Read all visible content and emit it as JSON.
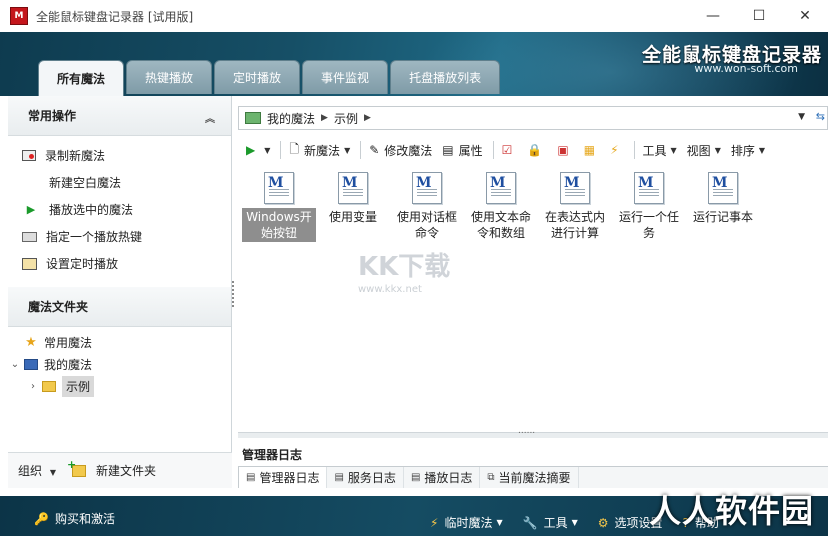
{
  "window": {
    "title": "全能鼠标键盘记录器 [试用版]",
    "logo": "M",
    "minimize": "—",
    "maximize": "☐",
    "close": "✕"
  },
  "header": {
    "brand": "全能鼠标键盘记录器",
    "url": "www.won-soft.com"
  },
  "tabs": [
    {
      "label": "所有魔法",
      "active": true
    },
    {
      "label": "热键播放"
    },
    {
      "label": "定时播放"
    },
    {
      "label": "事件监视"
    },
    {
      "label": "托盘播放列表"
    }
  ],
  "sidebar": {
    "common_ops_title": "常用操作",
    "ops": [
      {
        "label": "录制新魔法",
        "icon": "record-icon"
      },
      {
        "label": "新建空白魔法",
        "icon": ""
      },
      {
        "label": "播放选中的魔法",
        "icon": "play-icon"
      },
      {
        "label": "指定一个播放热键",
        "icon": "keyboard-icon"
      },
      {
        "label": "设置定时播放",
        "icon": "timer-icon"
      }
    ],
    "folders_title": "魔法文件夹",
    "tree": {
      "favorites": "常用魔法",
      "my_macros": "我的魔法",
      "examples": "示例"
    },
    "footer": {
      "organize": "组织",
      "new_folder": "新建文件夹"
    }
  },
  "address": {
    "seg1": "我的魔法",
    "seg2": "示例"
  },
  "toolbar": {
    "new_macro": "新魔法",
    "edit_macro": "修改魔法",
    "properties": "属性",
    "tools": "工具",
    "view": "视图",
    "sort": "排序"
  },
  "files": [
    {
      "name": "Windows开始按钮",
      "selected": true
    },
    {
      "name": "使用变量"
    },
    {
      "name": "使用对话框命令"
    },
    {
      "name": "使用文本命令和数组"
    },
    {
      "name": "在表达式内进行计算"
    },
    {
      "name": "运行一个任务"
    },
    {
      "name": "运行记事本"
    }
  ],
  "watermark": {
    "text": "KK下载",
    "url": "www.kkx.net"
  },
  "log": {
    "title": "管理器日志",
    "tabs": [
      "管理器日志",
      "服务日志",
      "播放日志",
      "当前魔法摘要"
    ]
  },
  "bottom": {
    "buy": "购买和激活",
    "temp_macro": "临时魔法",
    "tools": "工具",
    "options": "选项设置",
    "help": "帮助",
    "watermark": "人人软件园"
  }
}
